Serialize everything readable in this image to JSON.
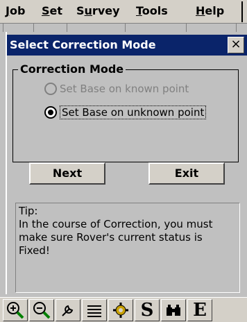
{
  "menu": {
    "items": [
      {
        "prefix": "",
        "underline": "J",
        "suffix": "ob"
      },
      {
        "prefix": "",
        "underline": "S",
        "suffix": "et"
      },
      {
        "prefix": "S",
        "underline": "u",
        "suffix": "rvey"
      },
      {
        "prefix": "",
        "underline": "T",
        "suffix": "ools"
      },
      {
        "prefix": "",
        "underline": "H",
        "suffix": "elp"
      }
    ]
  },
  "dialog": {
    "title": "Select Correction Mode",
    "close_label": "×",
    "group_label": "Correction Mode",
    "options": [
      {
        "label": "Set Base on known point",
        "selected": false,
        "enabled": false
      },
      {
        "label": "Set Base on unknown point",
        "selected": true,
        "enabled": true
      }
    ],
    "next_label": "Next",
    "exit_label": "Exit",
    "tip_title": "Tip:",
    "tip_text": "In the course of Correction, you must make sure Rover's current status is Fixed!"
  },
  "toolbar": {
    "tools": [
      {
        "icon": "zoom-in-icon"
      },
      {
        "icon": "zoom-out-icon"
      },
      {
        "icon": "wrench-icon"
      },
      {
        "icon": "list-icon"
      },
      {
        "icon": "gear-icon"
      },
      {
        "icon": "s-icon",
        "glyph": "S"
      },
      {
        "icon": "binoculars-icon"
      },
      {
        "icon": "e-icon",
        "glyph": "E"
      }
    ]
  },
  "colors": {
    "titlebar": "#0a246a",
    "dialog_bg": "#c0c0c0",
    "gear": "#c8a000"
  }
}
